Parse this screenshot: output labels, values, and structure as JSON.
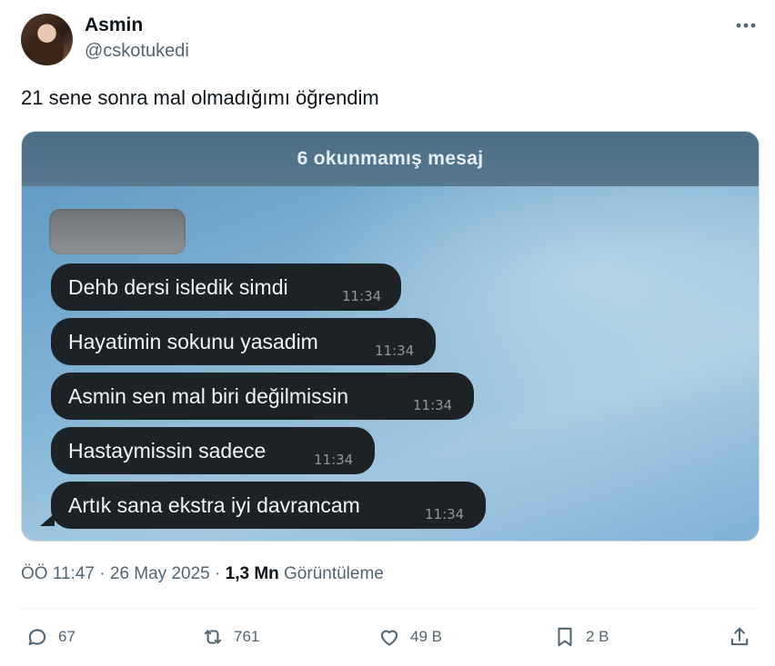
{
  "author": {
    "name": "Asmin",
    "handle": "@cskotukedi",
    "avatar_icon": "profile-photo"
  },
  "tweet": {
    "text": "21 sene sonra mal olmadığımı öğrendim"
  },
  "media": {
    "banner": "6 okunmamış mesaj",
    "messages": [
      {
        "text": "Dehb dersi isledik simdi",
        "time": "11:34"
      },
      {
        "text": "Hayatimin sokunu yasadim",
        "time": "11:34"
      },
      {
        "text": "Asmin sen mal biri değilmissin",
        "time": "11:34"
      },
      {
        "text": "Hastaymissin sadece",
        "time": "11:34"
      },
      {
        "text": "Artık sana ekstra iyi davrancam",
        "time": "11:34"
      }
    ]
  },
  "meta": {
    "time": "ÖÖ 11:47",
    "separator": "·",
    "date": "26 May 2025",
    "views_count": "1,3 Mn",
    "views_label": "Görüntüleme"
  },
  "actions": {
    "reply": "67",
    "repost": "761",
    "like": "49 B",
    "bookmark": "2 B"
  },
  "colors": {
    "text": "#0f1419",
    "secondary": "#536471",
    "bubble": "#1d2226"
  }
}
